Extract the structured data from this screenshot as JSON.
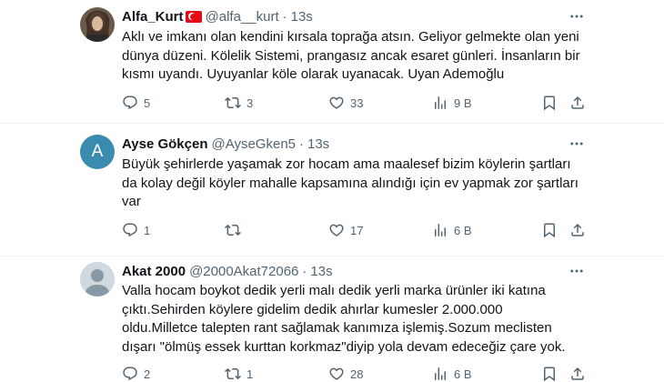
{
  "tweets": [
    {
      "display_name": "Alfa_Kurt",
      "flag": "turkey-flag",
      "handle": "@alfa__kurt",
      "separator": "·",
      "time": "13s",
      "lines": [
        "Aklı ve imkanı olan kendini kırsala toprağa atsın. Geliyor gelmekte olan yeni",
        "dünya düzeni. Kölelik Sistemi, prangasız ancak esaret günleri. İnsanların bir",
        "kısmı uyandı. Uyuyanlar köle olarak uyanacak. Uyan Ademoğlu"
      ],
      "replies": "5",
      "retweets": "3",
      "likes": "33",
      "views": "9 B"
    },
    {
      "display_name": "Ayse Gökçen",
      "avatar_letter": "A",
      "avatar_color": "#3a8bb0",
      "handle": "@AyseGken5",
      "separator": "·",
      "time": "13s",
      "lines": [
        "Büyük şehirlerde yaşamak zor hocam ama maalesef bizim köylerin şartları",
        "da kolay değil köyler mahalle kapsamına alındığı için ev yapmak zor şartları",
        "var"
      ],
      "replies": "1",
      "retweets": "",
      "likes": "17",
      "views": "6 B"
    },
    {
      "display_name": "Akat 2000",
      "handle": "@2000Akat72066",
      "separator": "·",
      "time": "13s",
      "lines": [
        "Valla hocam boykot dedik yerli malı dedik yerli marka ürünler iki katına",
        "çıktı.Sehirden köylere gidelim dedik ahırlar kumesler 2.000.000",
        "oldu.Milletce talepten rant sağlamak kanımıza işlemiş.Sozum meclisten",
        "dışarı \"ölmüş essek kurttan korkmaz\"diyip yola devam edeceğiz çare yok."
      ],
      "replies": "2",
      "retweets": "1",
      "likes": "28",
      "views": "6 B"
    }
  ],
  "colors": {
    "text": "#0f1419",
    "secondary": "#536471",
    "divider": "#eff3f4"
  },
  "icons": [
    "reply-icon",
    "retweet-icon",
    "like-icon",
    "views-icon",
    "bookmark-icon",
    "share-icon",
    "more-icon"
  ]
}
